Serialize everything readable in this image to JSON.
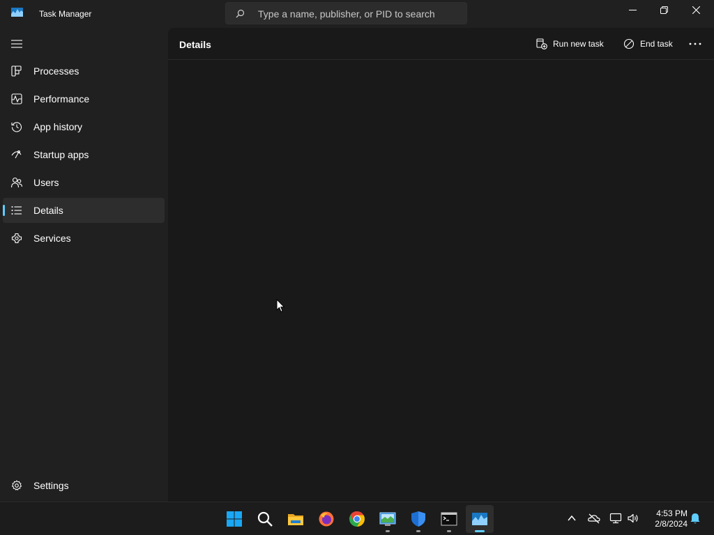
{
  "window": {
    "title": "Task Manager",
    "search_placeholder": "Type a name, publisher, or PID to search"
  },
  "nav": {
    "items": [
      {
        "label": "Processes",
        "icon": "processes-icon"
      },
      {
        "label": "Performance",
        "icon": "performance-icon"
      },
      {
        "label": "App history",
        "icon": "app-history-icon"
      },
      {
        "label": "Startup apps",
        "icon": "startup-apps-icon"
      },
      {
        "label": "Users",
        "icon": "users-icon"
      },
      {
        "label": "Details",
        "icon": "details-icon",
        "selected": true
      },
      {
        "label": "Services",
        "icon": "services-icon"
      }
    ],
    "settings_label": "Settings"
  },
  "main": {
    "title": "Details",
    "run_new_task_label": "Run new task",
    "end_task_label": "End task"
  },
  "taskbar": {
    "apps": [
      "windows-start-icon",
      "search-icon",
      "file-explorer-icon",
      "firefox-icon",
      "chrome-icon",
      "control-panel-icon",
      "windows-security-icon",
      "terminal-icon",
      "task-manager-icon"
    ],
    "time": "4:53 PM",
    "date": "2/8/2024"
  },
  "colors": {
    "accent": "#60cdff",
    "background": "#202020",
    "content_background": "#191919"
  }
}
